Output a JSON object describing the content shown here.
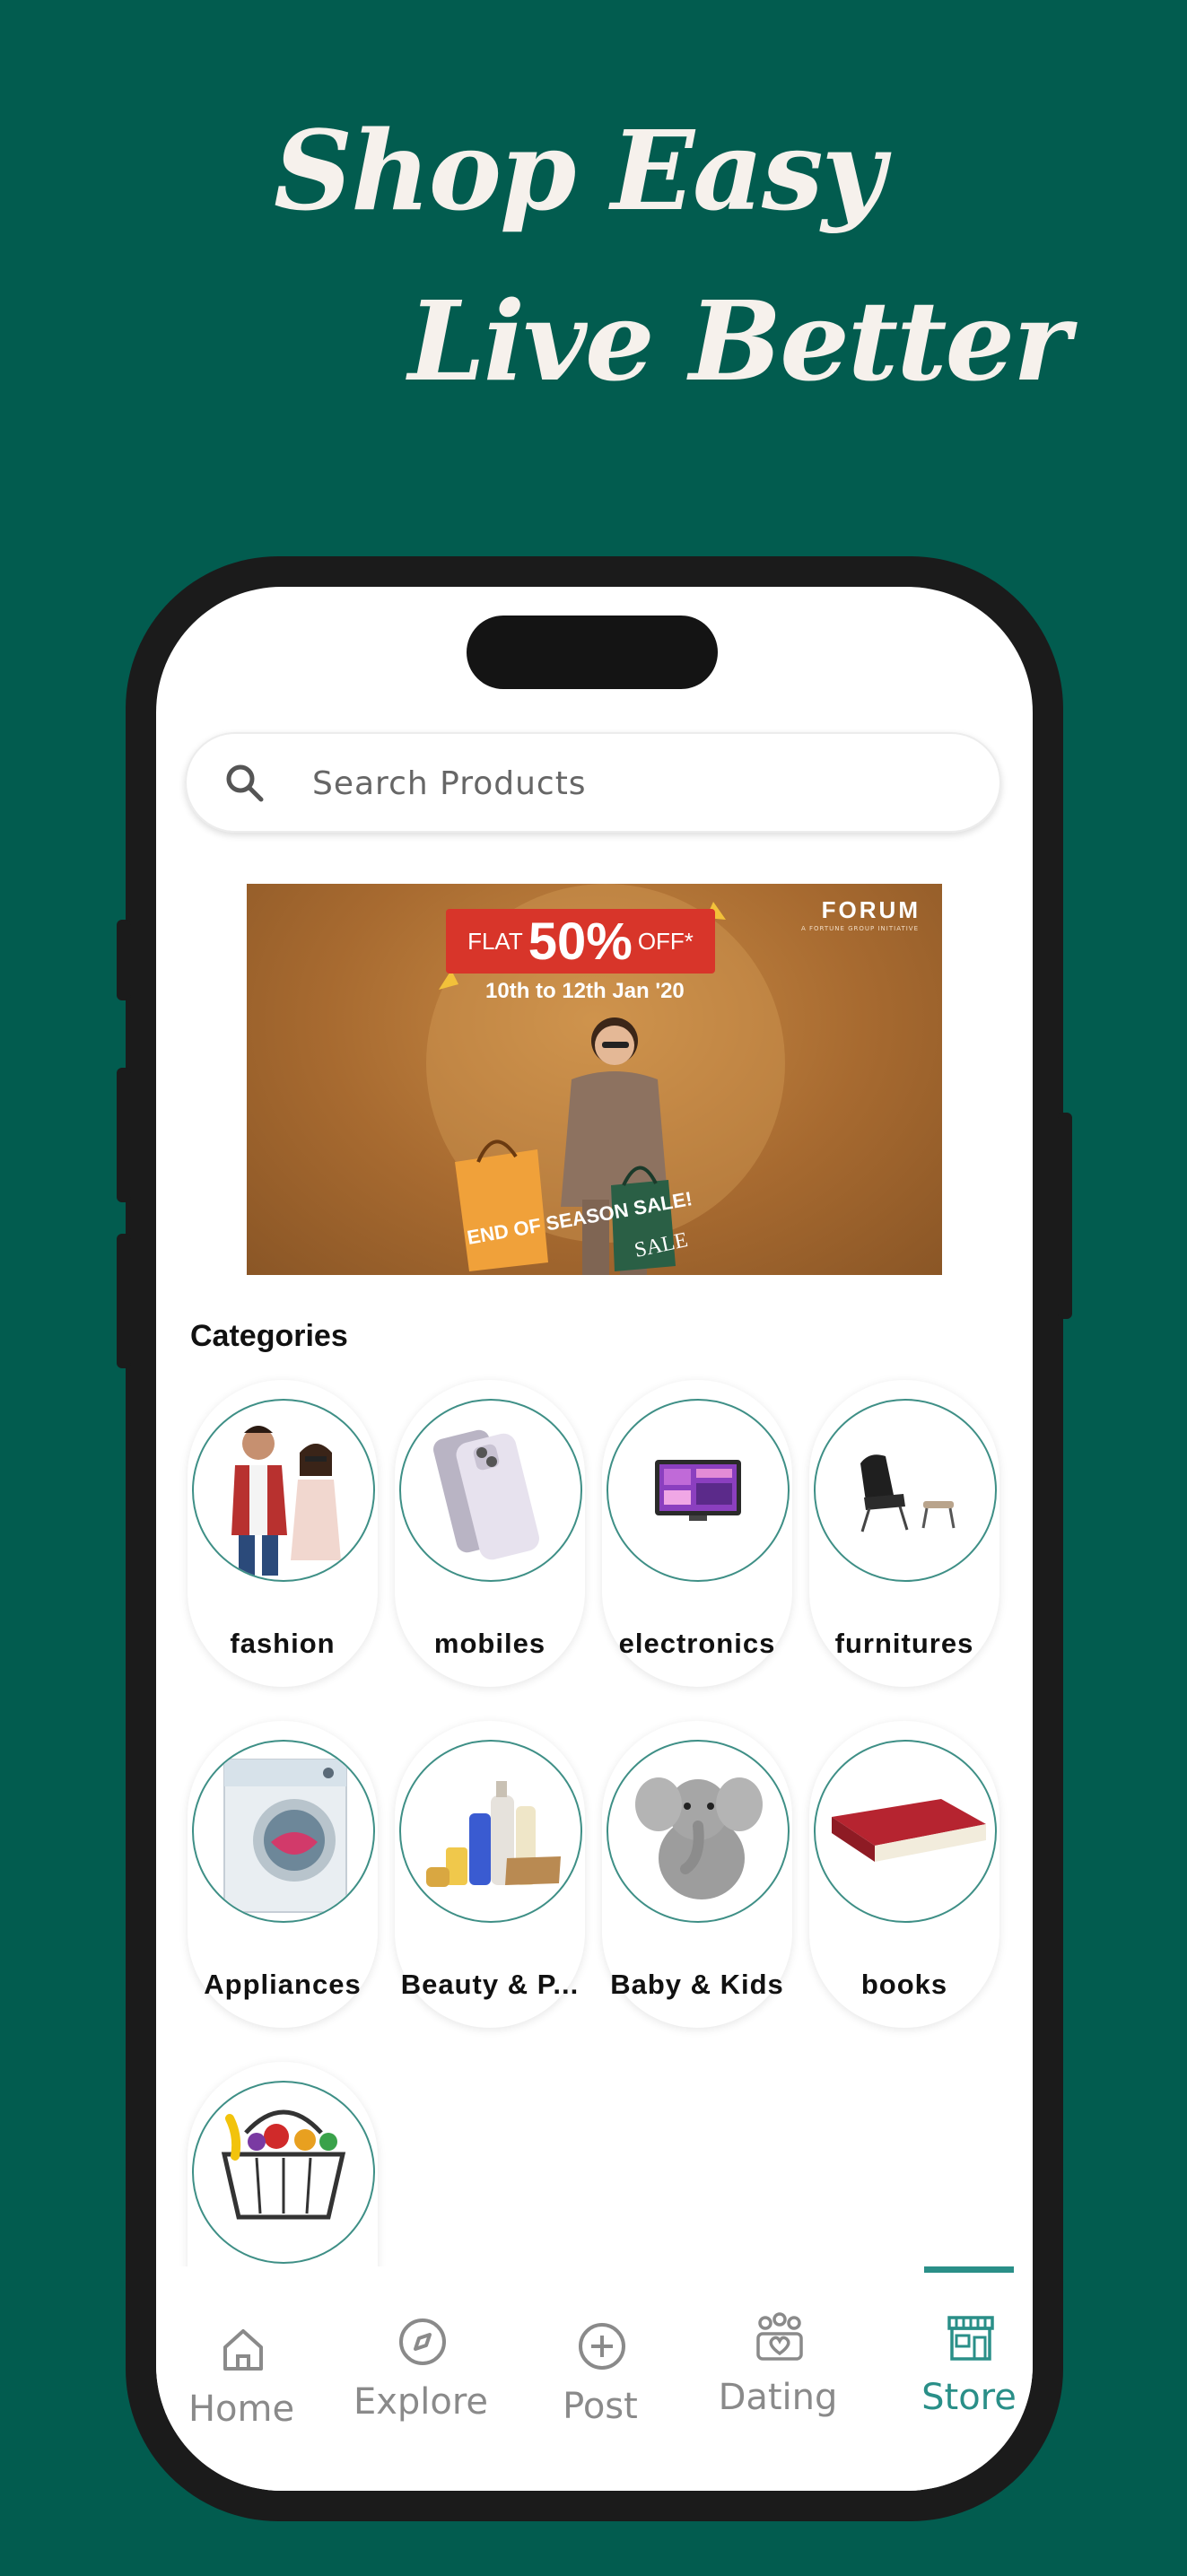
{
  "headline": {
    "line1": "Shop Easy",
    "line2": "Live Better"
  },
  "search": {
    "placeholder": "Search Products"
  },
  "banner": {
    "brand": "FORUM",
    "brand_sub": "A FORTUNE GROUP INITIATIVE",
    "offer_prefix": "FLAT",
    "offer_value": "50%",
    "offer_suffix": "OFF*",
    "dates": "10th to 12th Jan '20",
    "bag_text": "END OF SEASON SALE!",
    "bag2_text": "SALE"
  },
  "categories": {
    "title": "Categories",
    "items": [
      {
        "label": "fashion"
      },
      {
        "label": "mobiles"
      },
      {
        "label": "electronics"
      },
      {
        "label": "furnitures"
      },
      {
        "label": "Appliances"
      },
      {
        "label": "Beauty & P..."
      },
      {
        "label": "Baby & Kids"
      },
      {
        "label": "books"
      },
      {
        "label": ""
      }
    ]
  },
  "nav": {
    "items": [
      {
        "label": "Home",
        "icon": "home-icon"
      },
      {
        "label": "Explore",
        "icon": "compass-icon"
      },
      {
        "label": "Post",
        "icon": "plus-circle-icon"
      },
      {
        "label": "Dating",
        "icon": "people-heart-icon"
      },
      {
        "label": "Store",
        "icon": "store-icon",
        "active": true
      }
    ]
  },
  "colors": {
    "background": "#025c4f",
    "accent": "#2a8f88"
  }
}
